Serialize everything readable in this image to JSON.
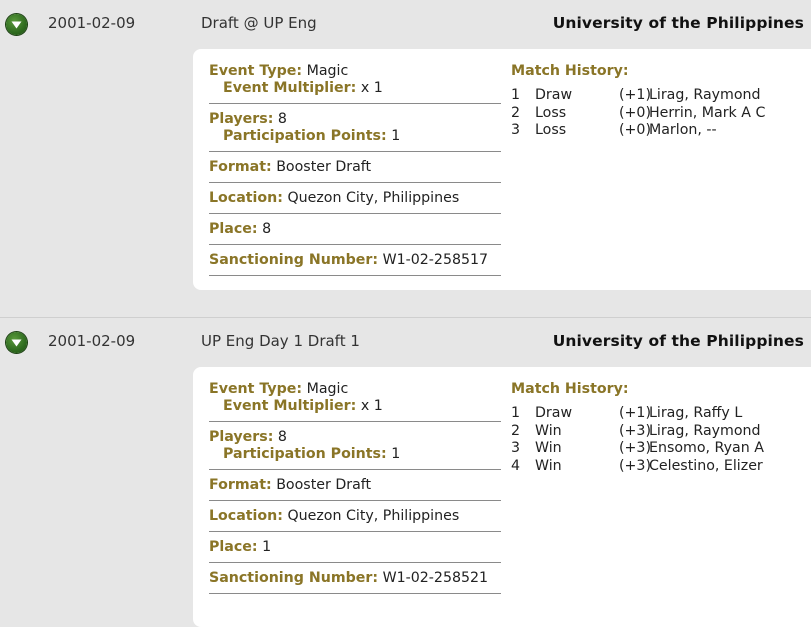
{
  "labels": {
    "event_type": "Event Type:",
    "event_multiplier": "Event Multiplier:",
    "players": "Players:",
    "participation_points": "Participation Points:",
    "format": "Format:",
    "location": "Location:",
    "place": "Place:",
    "sanctioning_number": "Sanctioning Number:",
    "match_history": "Match History:"
  },
  "events": [
    {
      "date": "2001-02-09",
      "name": "Draft @ UP Eng",
      "venue": "University of the Philippines",
      "event_type": "Magic",
      "event_multiplier": "x 1",
      "players": "8",
      "participation_points": "1",
      "format": "Booster Draft",
      "location": "Quezon City, Philippines",
      "place": "8",
      "sanctioning_number": "W1-02-258517",
      "matches": [
        {
          "num": "1",
          "result": "Draw",
          "points": "(+1)",
          "opponent": "Lirag, Raymond"
        },
        {
          "num": "2",
          "result": "Loss",
          "points": "(+0)",
          "opponent": "Herrin, Mark A C"
        },
        {
          "num": "3",
          "result": "Loss",
          "points": "(+0)",
          "opponent": "Marlon, --"
        }
      ]
    },
    {
      "date": "2001-02-09",
      "name": "UP Eng Day 1 Draft 1",
      "venue": "University of the Philippines",
      "event_type": "Magic",
      "event_multiplier": "x 1",
      "players": "8",
      "participation_points": "1",
      "format": "Booster Draft",
      "location": "Quezon City, Philippines",
      "place": "1",
      "sanctioning_number": "W1-02-258521",
      "matches": [
        {
          "num": "1",
          "result": "Draw",
          "points": "(+1)",
          "opponent": "Lirag, Raffy L"
        },
        {
          "num": "2",
          "result": "Win",
          "points": "(+3)",
          "opponent": "Lirag, Raymond"
        },
        {
          "num": "3",
          "result": "Win",
          "points": "(+3)",
          "opponent": "Ensomo, Ryan A"
        },
        {
          "num": "4",
          "result": "Win",
          "points": "(+3)",
          "opponent": "Celestino, Elizer"
        }
      ]
    }
  ]
}
